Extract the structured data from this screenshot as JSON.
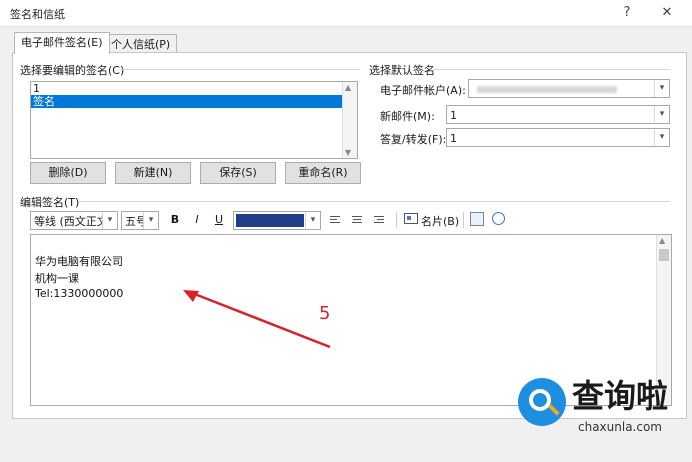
{
  "window": {
    "title": "签名和信纸",
    "help": "?",
    "close": "✕"
  },
  "tabs": [
    {
      "label": "电子邮件签名(E)",
      "active": true
    },
    {
      "label": "个人信纸(P)",
      "active": false
    }
  ],
  "select_sig": {
    "label": "选择要编辑的签名(C)",
    "items": [
      "1",
      "签名"
    ],
    "selected_index": 1
  },
  "buttons": {
    "delete": "删除(D)",
    "new": "新建(N)",
    "save": "保存(S)",
    "rename": "重命名(R)"
  },
  "default_sig": {
    "label": "选择默认签名",
    "account_label": "电子邮件帐户(A):",
    "new_label": "新邮件(M):",
    "new_value": "1",
    "reply_label": "答复/转发(F):",
    "reply_value": "1"
  },
  "edit_sig": {
    "label": "编辑签名(T)",
    "font": "等线 (西文正文)",
    "size": "五号",
    "bold": "B",
    "italic": "I",
    "underline": "U",
    "color_hex": "#1f3f8a",
    "card_label": "名片(B)",
    "lines": [
      "华为电脑有限公司",
      "机构一课",
      "Tel:1330000000"
    ]
  },
  "annotation": {
    "number": "5",
    "arrow_color": "#d7222b"
  },
  "watermark": {
    "brand": "查询啦",
    "url": "chaxunla.com",
    "accent": "#1e8fe0"
  }
}
